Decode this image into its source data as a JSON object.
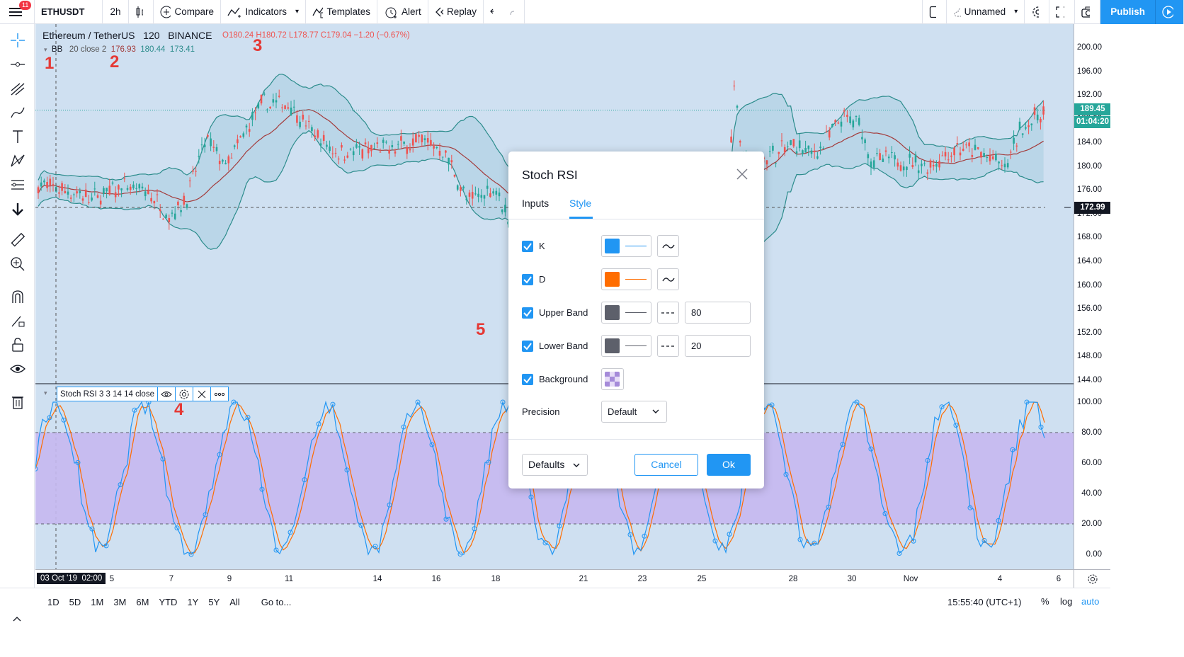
{
  "topbar": {
    "badge": "11",
    "symbol": "ETHUSDT",
    "interval": "2h",
    "compare": "Compare",
    "indicators": "Indicators",
    "templates": "Templates",
    "alert": "Alert",
    "replay": "Replay",
    "layout_name": "Unnamed",
    "publish": "Publish"
  },
  "legend": {
    "symbol_name": "Ethereum / TetherUS",
    "interval": "120",
    "exchange": "BINANCE",
    "open": "O180.24",
    "high": "H180.72",
    "low": "L178.77",
    "close": "C179.04",
    "change": "−1.20 (−0.67%)",
    "bb_name": "BB",
    "bb_params": "20 close 2",
    "bb_basis": "176.93",
    "bb_upper": "180.44",
    "bb_lower": "173.41",
    "stoch_label": "Stoch RSI 3 3 14 14 close"
  },
  "annotations": [
    "1",
    "2",
    "3",
    "4",
    "5"
  ],
  "price_scale": {
    "main": [
      "200.00",
      "196.00",
      "192.00",
      "188.00",
      "184.00",
      "180.00",
      "176.00",
      "172.00",
      "168.00",
      "164.00",
      "160.00",
      "156.00",
      "152.00",
      "148.00",
      "144.00"
    ],
    "stoch": [
      "100.00",
      "80.00",
      "60.00",
      "40.00",
      "20.00",
      "0.00"
    ],
    "last_price": "189.45",
    "countdown": "01:04:20",
    "crosshair_price": "172.99"
  },
  "time_axis": {
    "crosshair_date": "03 Oct '19",
    "crosshair_time": "02:00",
    "labels": [
      "5",
      "7",
      "9",
      "11",
      "14",
      "16",
      "18",
      "21",
      "23",
      "25",
      "28",
      "30",
      "Nov",
      "4",
      "6"
    ]
  },
  "bottombar": {
    "ranges": [
      "1D",
      "5D",
      "1M",
      "3M",
      "6M",
      "YTD",
      "1Y",
      "5Y",
      "All"
    ],
    "goto": "Go to...",
    "clock": "15:55:40 (UTC+1)",
    "percent": "%",
    "log": "log",
    "auto": "auto"
  },
  "dialog": {
    "title": "Stoch RSI",
    "tabs": [
      "Inputs",
      "Style"
    ],
    "active_tab": "Style",
    "rows": [
      {
        "label": "K",
        "checked": true,
        "color": "#2196f3"
      },
      {
        "label": "D",
        "checked": true,
        "color": "#ff6d00"
      },
      {
        "label": "Upper Band",
        "checked": true,
        "color": "#5d606b",
        "value": "80"
      },
      {
        "label": "Lower Band",
        "checked": true,
        "color": "#5d606b",
        "value": "20"
      },
      {
        "label": "Background",
        "checked": true
      }
    ],
    "precision_label": "Precision",
    "precision_value": "Default",
    "defaults_button": "Defaults",
    "cancel_button": "Cancel",
    "ok_button": "Ok"
  },
  "colors": {
    "chart_bg": "#cfe0f1",
    "up_candle": "#26a69a",
    "down_candle": "#ef5350",
    "bb_band": "#2c8c8c",
    "bb_basis": "#a33b3b",
    "stoch_k": "#2196f3",
    "stoch_d": "#ff6d00",
    "stoch_bg": "#c5b8f0",
    "accent": "#2196f3"
  }
}
